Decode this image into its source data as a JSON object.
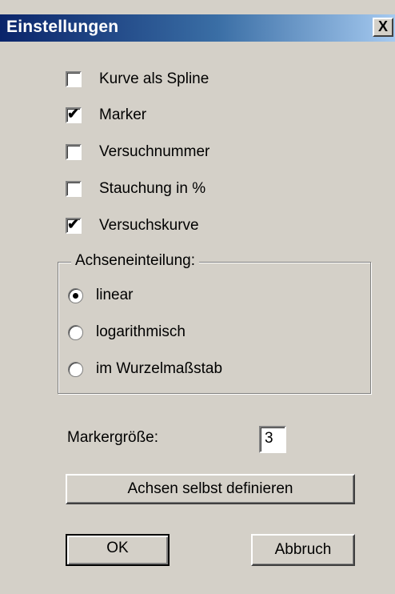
{
  "window": {
    "title": "Einstellungen",
    "close_label": "X"
  },
  "options": [
    {
      "label": "Kurve als Spline",
      "checked": false
    },
    {
      "label": "Marker",
      "checked": true
    },
    {
      "label": "Versuchnummer",
      "checked": false
    },
    {
      "label": "Stauchung in %",
      "checked": false
    },
    {
      "label": "Versuchskurve",
      "checked": true
    }
  ],
  "axis_group": {
    "legend": "Achseneinteilung:",
    "options": [
      {
        "label": "linear",
        "selected": true
      },
      {
        "label": "logarithmisch",
        "selected": false
      },
      {
        "label": "im Wurzelmaßstab",
        "selected": false
      }
    ]
  },
  "marker_size": {
    "label": "Markergröße:",
    "value": "3"
  },
  "buttons": {
    "define_axes": "Achsen selbst definieren",
    "ok": "OK",
    "cancel": "Abbruch"
  },
  "colors": {
    "dialog_bg": "#d4d0c8",
    "title_gradient_start": "#0a246a",
    "title_gradient_end": "#a6caf0"
  }
}
